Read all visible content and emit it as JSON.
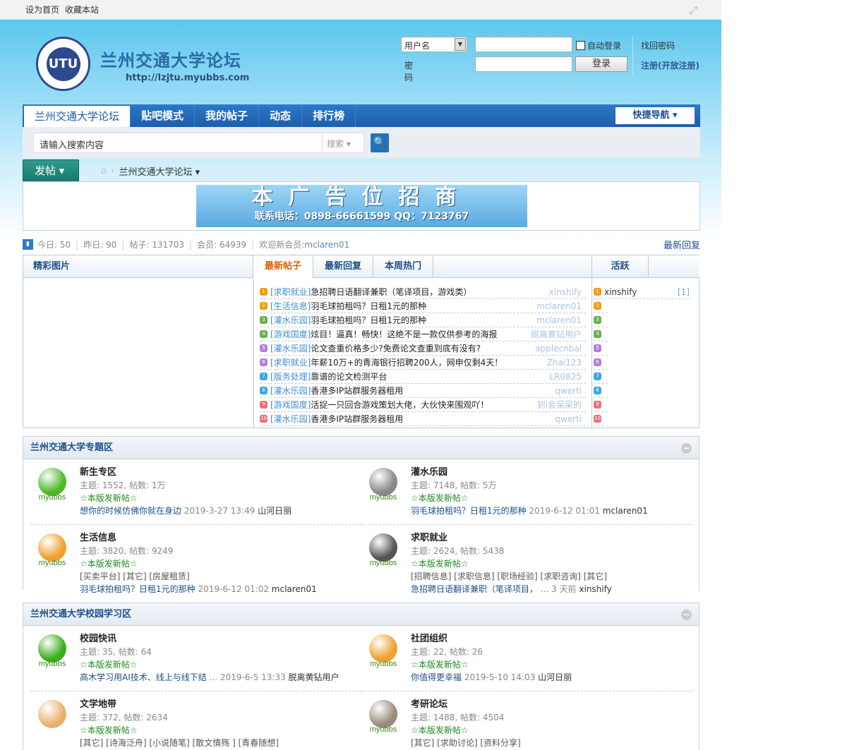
{
  "topbar": {
    "set_home": "设为首页",
    "bookmark": "收藏本站"
  },
  "header": {
    "logo_text": "UTU",
    "title": "兰州交通大学论坛",
    "url": "http://lzjtu.myubbs.com"
  },
  "login": {
    "field_type": "用户名",
    "password_label": "密码",
    "auto_login": "自动登录",
    "login_button": "登录",
    "forgot": "找回密码",
    "register": "注册(开放注册)"
  },
  "nav": {
    "tabs": [
      "兰州交通大学论坛",
      "贴吧模式",
      "我的帖子",
      "动态",
      "排行榜"
    ],
    "quick_nav": "快捷导航 ▾"
  },
  "search": {
    "placeholder": "请输入搜索内容",
    "type": "搜索 ▾",
    "button": "🔍"
  },
  "post_button": "发帖 ▾",
  "breadcrumb": {
    "home": "⌂",
    "sep": "›",
    "current": "兰州交通大学论坛 ▾"
  },
  "ad": {
    "line1": "本广告位招商",
    "line2": "联系电话：0898-66661599  QQ：7123767"
  },
  "stats": {
    "today": "今日: 50",
    "yesterday": "昨日: 90",
    "posts": "帖子: 131703",
    "members": "会员: 64939",
    "welcome": "欢迎新会员: ",
    "new_member": "mclaren01",
    "latest_reply": "最新回复"
  },
  "panel": {
    "pics_label": "精彩图片",
    "tabs": [
      "最新帖子",
      "最新回复",
      "本周热门"
    ],
    "active_tab": "活跃",
    "num_colors": [
      "#f39c12",
      "#f39c12",
      "#6ab04c",
      "#6ab04c",
      "#b57edc",
      "#b57edc",
      "#3aa8e0",
      "#3aa8e0",
      "#e8707a",
      "#e8707a"
    ],
    "posts": [
      {
        "cat": "[求职就业]",
        "title": "急招聘日语翻译兼职（笔译项目，游戏类）",
        "author": "xinshify"
      },
      {
        "cat": "[生活信息]",
        "title": "羽毛球拍租吗？日租1元的那种",
        "author": "mclaren01"
      },
      {
        "cat": "[灌水乐园]",
        "title": "羽毛球拍租吗？日租1元的那种",
        "author": "mclaren01"
      },
      {
        "cat": "[游戏国度]",
        "title": "炫目！逼真！畅快！这绝不是一款仅供参考的海报",
        "author": "脱离黄钻用户"
      },
      {
        "cat": "[灌水乐园]",
        "title": "论文查重价格多少?免费论文查重到底有没有?",
        "author": "applecnbal"
      },
      {
        "cat": "[求职就业]",
        "title": "年薪10万+的青海银行招聘200人，网申仅剩4天！",
        "author": "Zhai123"
      },
      {
        "cat": "[版务处理]",
        "title": "靠谱的论文检测平台",
        "author": "LR0825"
      },
      {
        "cat": "[灌水乐园]",
        "title": "香港多IP站群服务器租用",
        "author": "qwerti"
      },
      {
        "cat": "[游戏国度]",
        "title": "活捉一只回合游戏策划大佬，大伙快来围观吖！",
        "author": "到i会呆呆的"
      },
      {
        "cat": "[灌水乐园]",
        "title": "香港多IP站群服务器租用",
        "author": "qwerti"
      }
    ],
    "active_users": [
      {
        "name": "xinshify",
        "count": "[1]"
      }
    ],
    "nums": [
      "1",
      "2",
      "3",
      "4",
      "5",
      "6",
      "7",
      "8",
      "9",
      "10"
    ]
  },
  "sections": [
    {
      "title": "兰州交通大学专题区",
      "forums": [
        {
          "name": "新生专区",
          "stat": "主题: 1552, 帖数: 1万",
          "new": "☆本版发新帖☆",
          "last": "想你的时候仿佛你就在身边",
          "meta": "2019-3-27 13:49",
          "who": "山河日丽",
          "brand": "myubbs",
          "color": "#4cb82a"
        },
        {
          "name": "灌水乐园",
          "stat": "主题: 7148, 帖数: 5万",
          "new": "☆本版发新帖☆",
          "last": "羽毛球拍租吗？日租1元的那种",
          "meta": "2019-6-12 01:01",
          "who": "mclaren01",
          "brand": "myubbs",
          "color": "#888"
        },
        {
          "name": "生活信息",
          "stat": "主题: 3820, 帖数: 9249",
          "new": "☆本版发新帖☆",
          "subs": "[买卖平台] [其它] [房屋租赁]",
          "last": "羽毛球拍租吗？日租1元的那种",
          "meta": "2019-6-12 01:02",
          "who": "mclaren01",
          "brand": "myubbs",
          "color": "#f0a030"
        },
        {
          "name": "求职就业",
          "stat": "主题: 2624, 帖数: 5438",
          "new": "☆本版发新帖☆",
          "subs": "[招聘信息] [求职信息] [职场经验] [求职咨询] [其它]",
          "last": "急招聘日语翻译兼职（笔译项目，",
          "meta": "... 3 天前",
          "who": "xinshify",
          "brand": "myubbs",
          "color": "#555"
        }
      ]
    },
    {
      "title": "兰州交通大学校园学习区",
      "forums": [
        {
          "name": "校园快讯",
          "stat": "主题: 35, 帖数: 64",
          "new": "☆本版发新帖☆",
          "last": "高木学习用AI技术、线上与线下结",
          "meta": "... 2019-6-5 13:33",
          "who": "脱离黄钻用户",
          "brand": "myubbs",
          "color": "#3cae1c"
        },
        {
          "name": "社团组织",
          "stat": "主题: 22, 帖数: 26",
          "new": "☆本版发新帖☆",
          "last": "你值得更幸福",
          "meta": "2019-5-10 14:03",
          "who": "山河日丽",
          "brand": "myubbs",
          "color": "#f0a030"
        },
        {
          "name": "文学地带",
          "stat": "主题: 372, 帖数: 2634",
          "new": "☆本版发新帖☆",
          "subs": "[其它] [诗海泛舟] [小说随笔] [散文情殇 ] [青春随想]",
          "color": "#e8b070"
        },
        {
          "name": "考研论坛",
          "stat": "主题: 1488, 帖数: 4504",
          "new": "☆本版发新帖☆",
          "subs": "[其它] [求助讨论] [资料分享]",
          "brand": "myubbs",
          "color": "#9a8a7a"
        }
      ]
    }
  ]
}
